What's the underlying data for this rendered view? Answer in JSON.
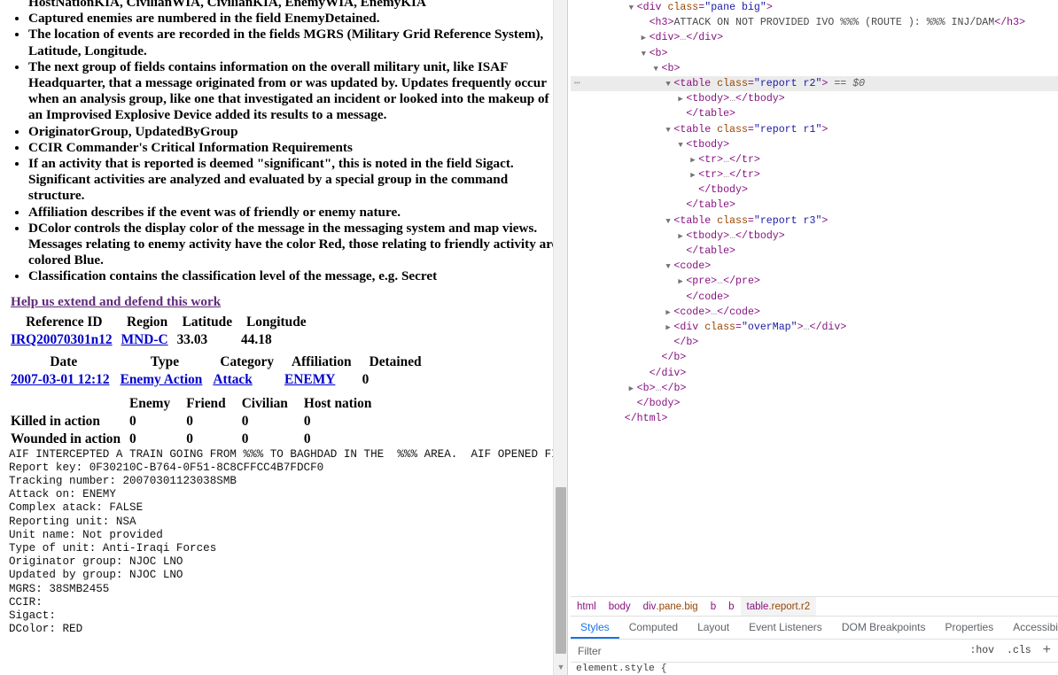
{
  "page": {
    "clipped_top_line": "HostNationKIA, CivilianWIA, CivilianKIA, EnemyWIA, EnemyKIA",
    "bullets": [
      "Captured enemies are numbered in the field EnemyDetained.",
      "The location of events are recorded in the fields MGRS (Military Grid Reference System), Latitude, Longitude.",
      "The next group of fields contains information on the overall military unit, like ISAF Headquarter, that a message originated from or was updated by. Updates frequently occur when an analysis group, like one that investigated an incident or looked into the makeup of an Improvised Explosive Device added its results to a message.",
      "OriginatorGroup, UpdatedByGroup",
      "CCIR Commander's Critical Information Requirements",
      "If an activity that is reported is deemed \"significant\", this is noted in the field Sigact. Significant activities are analyzed and evaluated by a special group in the command structure.",
      "Affiliation describes if the event was of friendly or enemy nature.",
      "DColor controls the display color of the message in the messaging system and map views. Messages relating to enemy activity have the color Red, those relating to friendly activity are colored Blue.",
      "Classification contains the classification level of the message, e.g. Secret"
    ],
    "help_link": "Help us extend and defend this work",
    "table_r2": {
      "headers": [
        "Reference ID",
        "Region",
        "Latitude",
        "Longitude"
      ],
      "row": [
        "IRQ20070301n12",
        "MND-C",
        "33.03",
        "44.18"
      ]
    },
    "table_r1": {
      "headers": [
        "Date",
        "Type",
        "Category",
        "Affiliation",
        "Detained"
      ],
      "row": [
        "2007-03-01 12:12",
        "Enemy Action",
        "Attack",
        "ENEMY",
        "0"
      ]
    },
    "table_r3": {
      "headers": [
        "",
        "Enemy",
        "Friend",
        "Civilian",
        "Host nation"
      ],
      "rows": [
        [
          "Killed in action",
          "0",
          "0",
          "0",
          "0"
        ],
        [
          "Wounded in action",
          "0",
          "0",
          "0",
          "0"
        ]
      ]
    },
    "narrative": "AIF INTERCEPTED A TRAIN GOING FROM %%% TO BAGHDAD IN THE  %%% AREA.  AIF OPENED FIRE WITH",
    "details": [
      "Report key: 0F30210C-B764-0F51-8C8CFFCC4B7FDCF0",
      "Tracking number: 20070301123038SMB",
      "Attack on: ENEMY",
      "Complex atack: FALSE",
      "Reporting unit: NSA",
      "Unit name: Not provided",
      "Type of unit: Anti-Iraqi Forces",
      "Originator group: NJOC LNO",
      "Updated by group: NJOC LNO",
      "MGRS: 38SMB2455",
      "CCIR:",
      "Sigact:",
      "DColor: RED"
    ]
  },
  "devtools": {
    "dom_rows": [
      {
        "indent": 1,
        "twisty": "open",
        "text_parts": [
          [
            "punc",
            "<"
          ],
          [
            "tag",
            "div"
          ],
          [
            "attr",
            " class"
          ],
          [
            "punc",
            "="
          ],
          [
            "val",
            "\"pane big\""
          ],
          [
            "punc",
            ">"
          ]
        ]
      },
      {
        "indent": 2,
        "twisty": "none",
        "text_parts": [
          [
            "punc",
            "<"
          ],
          [
            "tag",
            "h3"
          ],
          [
            "punc",
            ">"
          ],
          [
            "txt",
            "ATTACK ON NOT PROVIDED IVO %%% (ROUTE ): %%% INJ/DAM"
          ],
          [
            "punc",
            "</"
          ],
          [
            "tag",
            "h3"
          ],
          [
            "punc",
            ">"
          ]
        ]
      },
      {
        "indent": 2,
        "twisty": "closed",
        "text_parts": [
          [
            "punc",
            "<"
          ],
          [
            "tag",
            "div"
          ],
          [
            "punc",
            ">"
          ],
          [
            "ellip",
            "…"
          ],
          [
            "punc",
            "</"
          ],
          [
            "tag",
            "div"
          ],
          [
            "punc",
            ">"
          ]
        ]
      },
      {
        "indent": 2,
        "twisty": "open",
        "text_parts": [
          [
            "punc",
            "<"
          ],
          [
            "tag",
            "b"
          ],
          [
            "punc",
            ">"
          ]
        ]
      },
      {
        "indent": 3,
        "twisty": "open",
        "text_parts": [
          [
            "punc",
            "<"
          ],
          [
            "tag",
            "b"
          ],
          [
            "punc",
            ">"
          ]
        ]
      },
      {
        "indent": 4,
        "twisty": "open",
        "selected": true,
        "text_parts": [
          [
            "punc",
            "<"
          ],
          [
            "tag",
            "table"
          ],
          [
            "attr",
            " class"
          ],
          [
            "punc",
            "="
          ],
          [
            "val",
            "\"report r2\""
          ],
          [
            "punc",
            ">"
          ],
          [
            "sel0",
            " == $0"
          ]
        ]
      },
      {
        "indent": 5,
        "twisty": "closed",
        "text_parts": [
          [
            "punc",
            "<"
          ],
          [
            "tag",
            "tbody"
          ],
          [
            "punc",
            ">"
          ],
          [
            "ellip",
            "…"
          ],
          [
            "punc",
            "</"
          ],
          [
            "tag",
            "tbody"
          ],
          [
            "punc",
            ">"
          ]
        ]
      },
      {
        "indent": 5,
        "twisty": "none",
        "text_parts": [
          [
            "punc",
            "</"
          ],
          [
            "tag",
            "table"
          ],
          [
            "punc",
            ">"
          ]
        ]
      },
      {
        "indent": 4,
        "twisty": "open",
        "text_parts": [
          [
            "punc",
            "<"
          ],
          [
            "tag",
            "table"
          ],
          [
            "attr",
            " class"
          ],
          [
            "punc",
            "="
          ],
          [
            "val",
            "\"report r1\""
          ],
          [
            "punc",
            ">"
          ]
        ]
      },
      {
        "indent": 5,
        "twisty": "open",
        "text_parts": [
          [
            "punc",
            "<"
          ],
          [
            "tag",
            "tbody"
          ],
          [
            "punc",
            ">"
          ]
        ]
      },
      {
        "indent": 6,
        "twisty": "closed",
        "text_parts": [
          [
            "punc",
            "<"
          ],
          [
            "tag",
            "tr"
          ],
          [
            "punc",
            ">"
          ],
          [
            "ellip",
            "…"
          ],
          [
            "punc",
            "</"
          ],
          [
            "tag",
            "tr"
          ],
          [
            "punc",
            ">"
          ]
        ]
      },
      {
        "indent": 6,
        "twisty": "closed",
        "text_parts": [
          [
            "punc",
            "<"
          ],
          [
            "tag",
            "tr"
          ],
          [
            "punc",
            ">"
          ],
          [
            "ellip",
            "…"
          ],
          [
            "punc",
            "</"
          ],
          [
            "tag",
            "tr"
          ],
          [
            "punc",
            ">"
          ]
        ]
      },
      {
        "indent": 6,
        "twisty": "none",
        "text_parts": [
          [
            "punc",
            "</"
          ],
          [
            "tag",
            "tbody"
          ],
          [
            "punc",
            ">"
          ]
        ]
      },
      {
        "indent": 5,
        "twisty": "none",
        "text_parts": [
          [
            "punc",
            "</"
          ],
          [
            "tag",
            "table"
          ],
          [
            "punc",
            ">"
          ]
        ]
      },
      {
        "indent": 4,
        "twisty": "open",
        "text_parts": [
          [
            "punc",
            "<"
          ],
          [
            "tag",
            "table"
          ],
          [
            "attr",
            " class"
          ],
          [
            "punc",
            "="
          ],
          [
            "val",
            "\"report r3\""
          ],
          [
            "punc",
            ">"
          ]
        ]
      },
      {
        "indent": 5,
        "twisty": "closed",
        "text_parts": [
          [
            "punc",
            "<"
          ],
          [
            "tag",
            "tbody"
          ],
          [
            "punc",
            ">"
          ],
          [
            "ellip",
            "…"
          ],
          [
            "punc",
            "</"
          ],
          [
            "tag",
            "tbody"
          ],
          [
            "punc",
            ">"
          ]
        ]
      },
      {
        "indent": 5,
        "twisty": "none",
        "text_parts": [
          [
            "punc",
            "</"
          ],
          [
            "tag",
            "table"
          ],
          [
            "punc",
            ">"
          ]
        ]
      },
      {
        "indent": 4,
        "twisty": "open",
        "text_parts": [
          [
            "punc",
            "<"
          ],
          [
            "tag",
            "code"
          ],
          [
            "punc",
            ">"
          ]
        ]
      },
      {
        "indent": 5,
        "twisty": "closed",
        "text_parts": [
          [
            "punc",
            "<"
          ],
          [
            "tag",
            "pre"
          ],
          [
            "punc",
            ">"
          ],
          [
            "ellip",
            "…"
          ],
          [
            "punc",
            "</"
          ],
          [
            "tag",
            "pre"
          ],
          [
            "punc",
            ">"
          ]
        ]
      },
      {
        "indent": 5,
        "twisty": "none",
        "text_parts": [
          [
            "punc",
            "</"
          ],
          [
            "tag",
            "code"
          ],
          [
            "punc",
            ">"
          ]
        ]
      },
      {
        "indent": 4,
        "twisty": "closed",
        "text_parts": [
          [
            "punc",
            "<"
          ],
          [
            "tag",
            "code"
          ],
          [
            "punc",
            ">"
          ],
          [
            "ellip",
            "…"
          ],
          [
            "punc",
            "</"
          ],
          [
            "tag",
            "code"
          ],
          [
            "punc",
            ">"
          ]
        ]
      },
      {
        "indent": 4,
        "twisty": "closed",
        "text_parts": [
          [
            "punc",
            "<"
          ],
          [
            "tag",
            "div"
          ],
          [
            "attr",
            " class"
          ],
          [
            "punc",
            "="
          ],
          [
            "val",
            "\"overMap\""
          ],
          [
            "punc",
            ">"
          ],
          [
            "ellip",
            "…"
          ],
          [
            "punc",
            "</"
          ],
          [
            "tag",
            "div"
          ],
          [
            "punc",
            ">"
          ]
        ]
      },
      {
        "indent": 4,
        "twisty": "none",
        "text_parts": [
          [
            "punc",
            "</"
          ],
          [
            "tag",
            "b"
          ],
          [
            "punc",
            ">"
          ]
        ]
      },
      {
        "indent": 3,
        "twisty": "none",
        "text_parts": [
          [
            "punc",
            "</"
          ],
          [
            "tag",
            "b"
          ],
          [
            "punc",
            ">"
          ]
        ]
      },
      {
        "indent": 2,
        "twisty": "none",
        "text_parts": [
          [
            "punc",
            "</"
          ],
          [
            "tag",
            "div"
          ],
          [
            "punc",
            ">"
          ]
        ]
      },
      {
        "indent": 1,
        "twisty": "closed",
        "text_parts": [
          [
            "punc",
            "<"
          ],
          [
            "tag",
            "b"
          ],
          [
            "punc",
            ">"
          ],
          [
            "ellip",
            "…"
          ],
          [
            "punc",
            "</"
          ],
          [
            "tag",
            "b"
          ],
          [
            "punc",
            ">"
          ]
        ]
      },
      {
        "indent": 1,
        "twisty": "none",
        "text_parts": [
          [
            "punc",
            "</"
          ],
          [
            "tag",
            "body"
          ],
          [
            "punc",
            ">"
          ]
        ]
      },
      {
        "indent": 0,
        "twisty": "none",
        "text_parts": [
          [
            "punc",
            "</"
          ],
          [
            "tag",
            "html"
          ],
          [
            "punc",
            ">"
          ]
        ]
      }
    ],
    "breadcrumbs": [
      {
        "tag": "html",
        "cls": "",
        "active": false
      },
      {
        "tag": "body",
        "cls": "",
        "active": false
      },
      {
        "tag": "div",
        "cls": ".pane.big",
        "active": false
      },
      {
        "tag": "b",
        "cls": "",
        "active": false
      },
      {
        "tag": "b",
        "cls": "",
        "active": false
      },
      {
        "tag": "table",
        "cls": ".report.r2",
        "active": true
      }
    ],
    "tabs": [
      {
        "label": "Styles",
        "active": true
      },
      {
        "label": "Computed",
        "active": false
      },
      {
        "label": "Layout",
        "active": false
      },
      {
        "label": "Event Listeners",
        "active": false
      },
      {
        "label": "DOM Breakpoints",
        "active": false
      },
      {
        "label": "Properties",
        "active": false
      },
      {
        "label": "Accessibility",
        "active": false
      }
    ],
    "filter": {
      "placeholder": "Filter",
      "value": "",
      "hov_label": ":hov",
      "cls_label": ".cls",
      "plus_label": "+"
    },
    "styles_first_line": "element.style {",
    "accent_color": "#1a73e8"
  }
}
